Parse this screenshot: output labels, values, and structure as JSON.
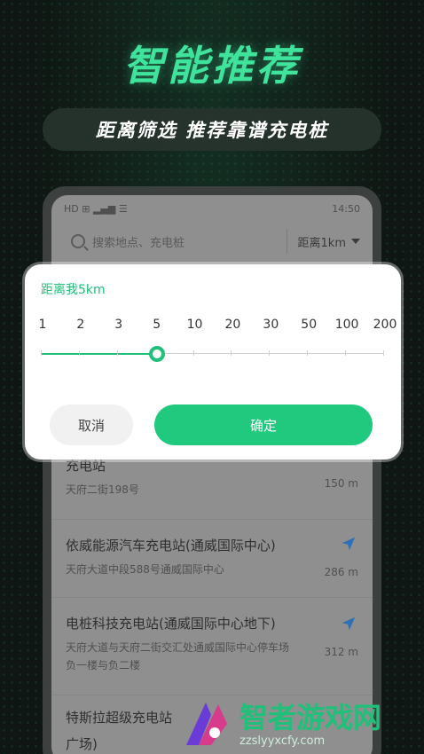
{
  "promo": {
    "headline": "智能推荐",
    "subline": "距离筛选  推荐靠谱充电桩"
  },
  "status_bar": {
    "time": "14:50",
    "left_icons": "HD ⊞ ▂▄▆ ☰"
  },
  "search": {
    "placeholder": "搜索地点、充电桩",
    "range_label": "距离1km"
  },
  "modal": {
    "title": "距离我5km",
    "ticks": [
      "1",
      "2",
      "3",
      "5",
      "10",
      "20",
      "30",
      "50",
      "100",
      "200"
    ],
    "selected_index": 3,
    "cancel_label": "取消",
    "confirm_label": "确定"
  },
  "stations": [
    {
      "name": "充电站",
      "address": "天府二街198号",
      "distance": "150 m"
    },
    {
      "name": "依威能源汽车充电站(通威国际中心)",
      "address": "天府大道中段588号通威国际中心",
      "distance": "286 m"
    },
    {
      "name": "电桩科技充电站(通威国际中心地下)",
      "address": "天府大道与天府二街交汇处通威国际中心停车场",
      "address2": "负一楼与负二楼",
      "distance": "312 m"
    },
    {
      "name": "特斯拉超级充电站",
      "name2": "广场)"
    }
  ],
  "watermark": {
    "title": "智者游戏网",
    "url": "zzslyyxcfy.com"
  },
  "colors": {
    "accent": "#20c07a",
    "headline": "#3fe39c"
  }
}
